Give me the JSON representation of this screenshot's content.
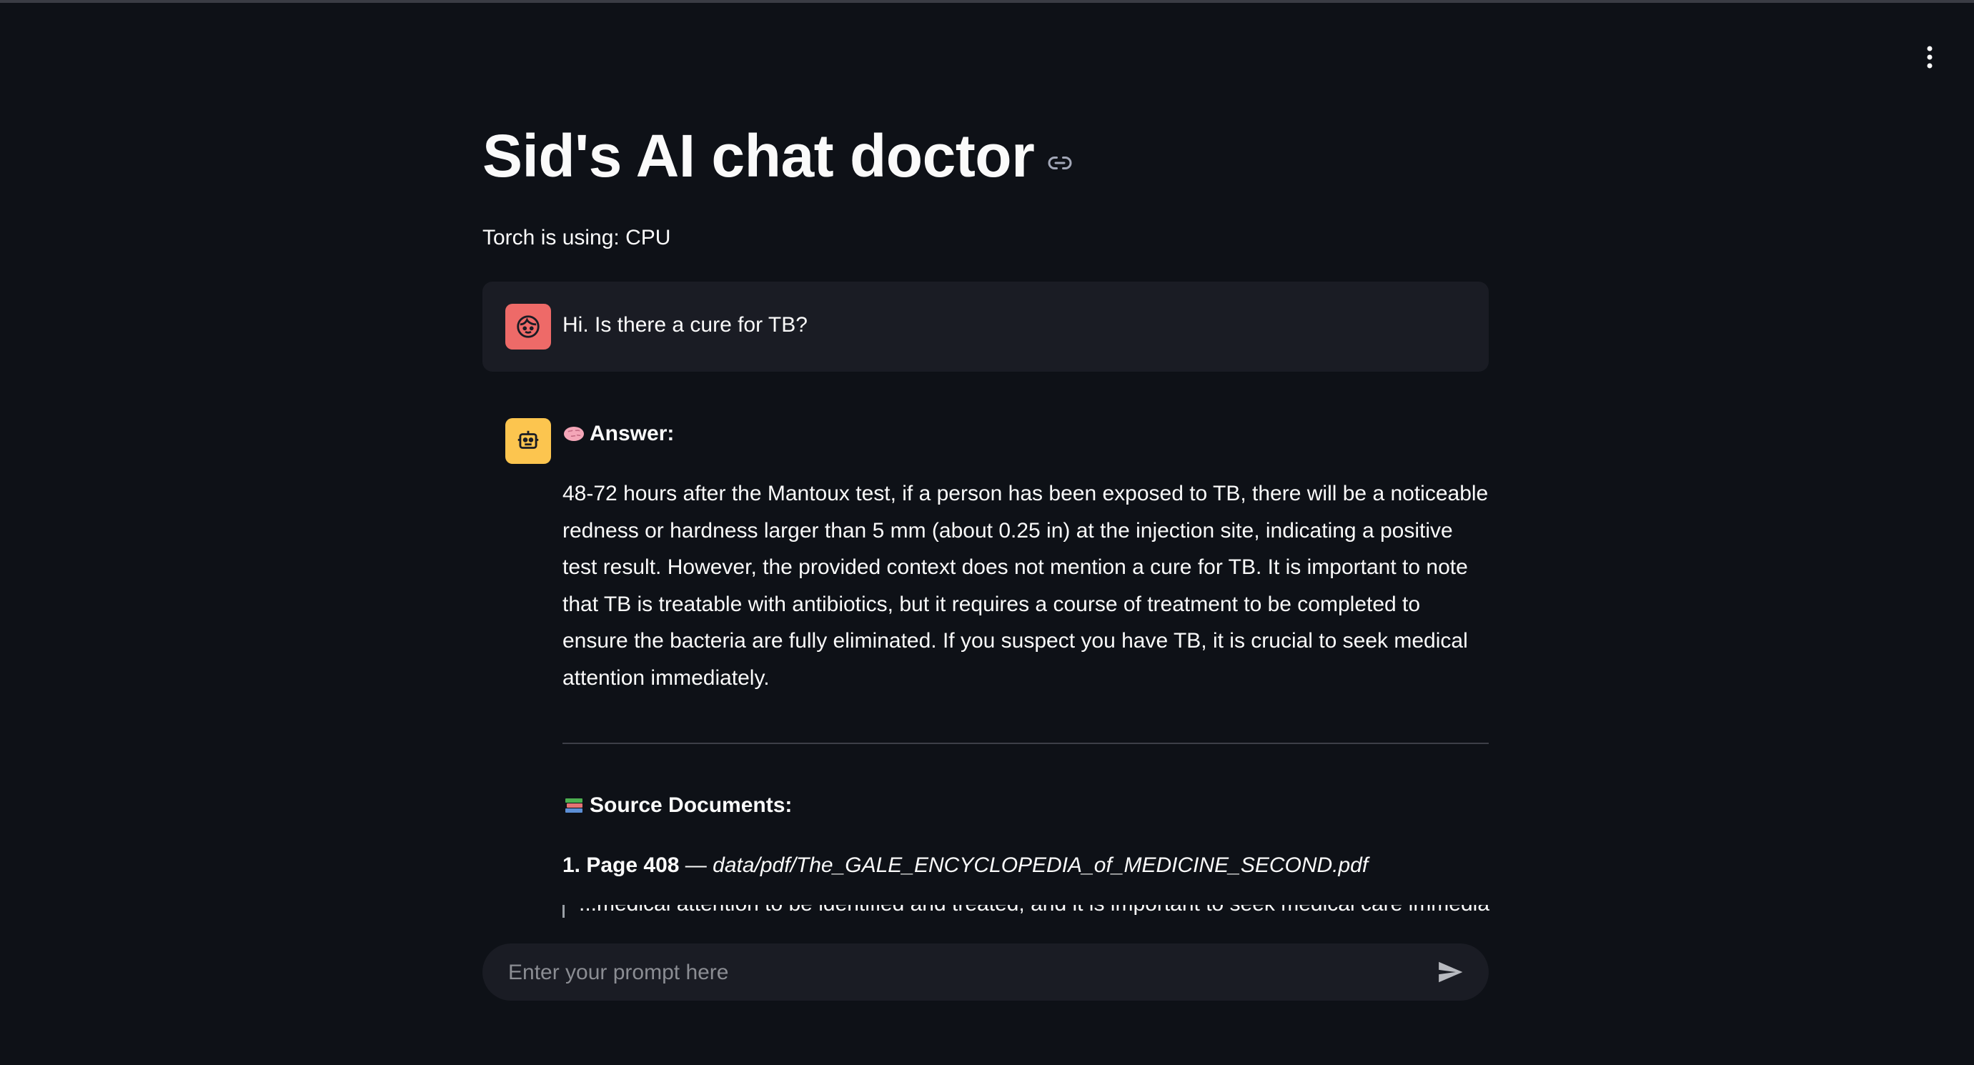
{
  "header": {
    "menu_icon": "vertical-dots-icon"
  },
  "page": {
    "title": "Sid's AI chat doctor",
    "anchor_icon": "link-icon",
    "subtitle": "Torch is using: CPU"
  },
  "chat": {
    "user_message": {
      "avatar_icon": "user-face-icon",
      "avatar_color": "#ee6a68",
      "text": "Hi. Is there a cure for TB?"
    },
    "assistant_message": {
      "avatar_icon": "robot-icon",
      "avatar_color": "#fcc54f",
      "answer_emoji": "brain-emoji",
      "answer_label": "Answer:",
      "answer_text": "48-72 hours after the Mantoux test, if a person has been exposed to TB, there will be a noticeable redness or hardness larger than 5 mm (about 0.25 in) at the injection site, indicating a positive test result. However, the provided context does not mention a cure for TB. It is important to note that TB is treatable with antibiotics, but it requires a course of treatment to be completed to ensure the bacteria are fully eliminated. If you suspect you have TB, it is crucial to seek medical attention immediately.",
      "sources_emoji": "books-emoji",
      "sources_label": "Source Documents:",
      "sources": [
        {
          "index": "1. Page 408",
          "separator": "—",
          "path": "data/pdf/The_GALE_ENCYCLOPEDIA_of_MEDICINE_SECOND.pdf"
        }
      ],
      "cut_off_excerpt": "...medical attention to be identified and treated, and it is important to seek medical care immediately if signs of tuberculosis"
    }
  },
  "input": {
    "placeholder": "Enter your prompt here",
    "value": "",
    "send_icon": "send-arrow-icon"
  }
}
